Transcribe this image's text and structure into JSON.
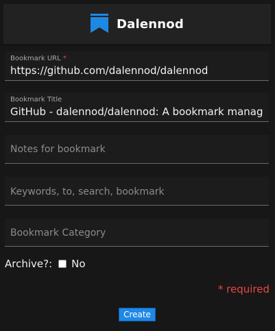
{
  "header": {
    "title": "Dalennod",
    "logo_icon": "bookmark-icon",
    "logo_color": "#1e88e5"
  },
  "form": {
    "url": {
      "label": "Bookmark URL",
      "required_marker": "*",
      "value": "https://github.com/dalennod/dalennod"
    },
    "title": {
      "label": "Bookmark Title",
      "value": "GitHub - dalennod/dalennod: A bookmark manag"
    },
    "notes": {
      "placeholder": "Notes for bookmark"
    },
    "keywords": {
      "placeholder": "Keywords, to, search, bookmark"
    },
    "category": {
      "placeholder": "Bookmark Category"
    },
    "archive": {
      "label": "Archive?:",
      "option_label": "No",
      "checked": false
    },
    "required_note": "* required",
    "submit_label": "Create"
  },
  "colors": {
    "background": "#171717",
    "accent": "#1e88e5",
    "required": "#ef4444"
  }
}
